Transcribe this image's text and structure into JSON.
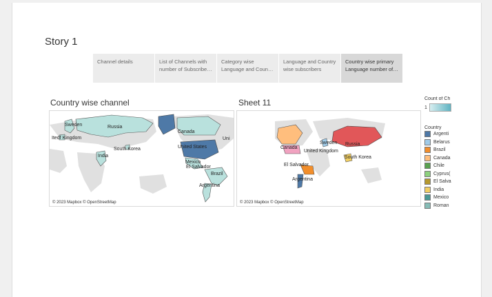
{
  "story_title": "Story 1",
  "tabs": [
    {
      "line1": "Channel details",
      "line2": ""
    },
    {
      "line1": "List of Channels with",
      "line2": "number of Subscriber..."
    },
    {
      "line1": "Category wise",
      "line2": "Language and Countr..."
    },
    {
      "line1": "Language and Country",
      "line2": "wise subscribers"
    },
    {
      "line1": "Country wise primary",
      "line2": "Language number of ..."
    }
  ],
  "sheet_left": {
    "title": "Country wise channel",
    "labels": [
      "Sweden",
      "Russia",
      "Canada",
      "Itedf Kingdom",
      "South Korea",
      "India",
      "United States",
      "Uni",
      "Mexico",
      "El Salvador",
      "Brazil",
      "Argentina"
    ],
    "credit": "© 2023 Mapbox © OpenStreetMap"
  },
  "sheet_right": {
    "title": "Sheet 11",
    "labels": [
      "Sweden",
      "Canada",
      "Russia",
      "United Kingdom",
      "South Korea",
      "El Salvador",
      "Argentina"
    ],
    "credit": "© 2023 Mapbox © OpenStreetMap"
  },
  "legend": {
    "count_title": "Count of Ch",
    "count_min": "1",
    "country_title": "Country",
    "items": [
      {
        "name": "Argenti",
        "color": "#4e79a7"
      },
      {
        "name": "Belarus",
        "color": "#a0cbe8"
      },
      {
        "name": "Brazil",
        "color": "#f28e2b"
      },
      {
        "name": "Canada",
        "color": "#ffbe7d"
      },
      {
        "name": "Chile",
        "color": "#59a14f"
      },
      {
        "name": "Cyprus(",
        "color": "#8cd17d"
      },
      {
        "name": "El Salva",
        "color": "#b6992d"
      },
      {
        "name": "India",
        "color": "#f1ce63"
      },
      {
        "name": "Mexico",
        "color": "#499894"
      },
      {
        "name": "Roman",
        "color": "#86bcb6"
      }
    ]
  },
  "colors": {
    "land": "#e0e0e0",
    "teal": "#b9e1dd",
    "dark_blue": "#4e79a7",
    "red": "#e15759",
    "orange": "#f28e2b",
    "pink": "#f1a2c0"
  }
}
